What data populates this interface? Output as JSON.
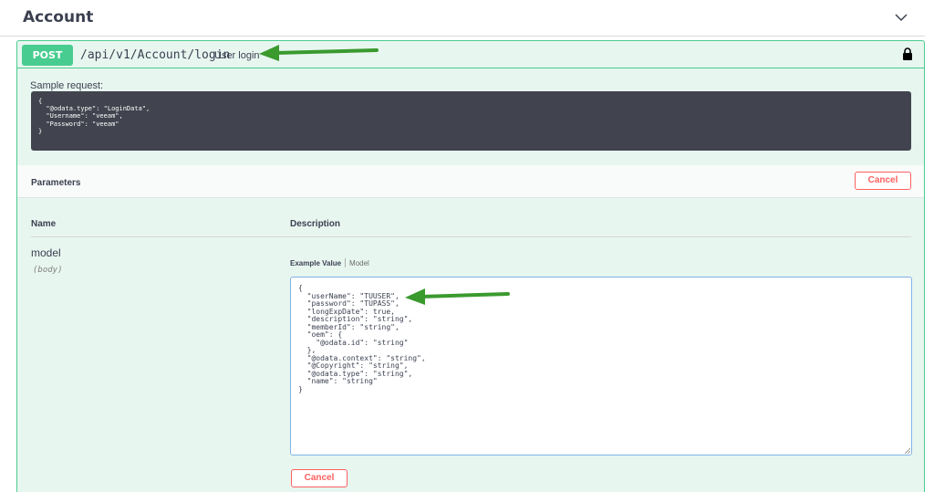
{
  "tag": {
    "title": "Account",
    "chevron_icon": "chevron-down-icon"
  },
  "operation": {
    "method": "POST",
    "path": "/api/v1/Account/login",
    "summary": "User login",
    "lock_icon": "lock-icon",
    "colors": {
      "accent": "#49cc90",
      "background": "#e8f6f0",
      "cancel": "#ff6060"
    }
  },
  "description": {
    "label": "Sample request:",
    "code_lines": [
      "{",
      "  \"@odata.type\": \"LoginData\",",
      "  \"Username\": \"veeam\",",
      "  \"Password\": \"veeam\"",
      "}"
    ]
  },
  "parameters": {
    "title": "Parameters",
    "cancel_label": "Cancel",
    "columns": {
      "name": "Name",
      "description": "Description"
    },
    "param": {
      "name": "model",
      "in": "(body)"
    },
    "tabs": {
      "example": "Example Value",
      "model": "Model"
    },
    "body_lines": [
      "{",
      "  \"userName\": \"TUUSER\",",
      "  \"password\": \"TUPASS\",",
      "  \"longExpDate\": true,",
      "  \"description\": \"string\",",
      "  \"memberId\": \"string\",",
      "  \"oem\": {",
      "    \"@odata.id\": \"string\"",
      "  },",
      "  \"@odata.context\": \"string\",",
      "  \"@Copyright\": \"string\",",
      "  \"@odata.type\": \"string\",",
      "  \"name\": \"string\"",
      "}"
    ],
    "bottom_cancel_label": "Cancel"
  }
}
